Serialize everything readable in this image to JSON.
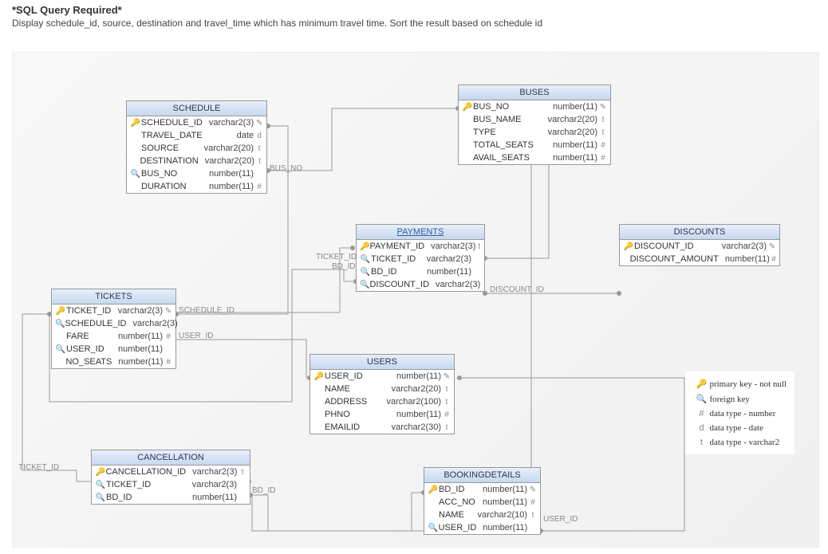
{
  "header": {
    "title": "*SQL Query Required*",
    "subtitle": "Display schedule_id, source, destination and travel_time which has minimum travel time. Sort the result based on schedule id"
  },
  "tables": {
    "schedule": {
      "title": "SCHEDULE",
      "cols": [
        {
          "ico": "pk",
          "name": "SCHEDULE_ID",
          "type": "varchar2(3)",
          "flag": "✎"
        },
        {
          "ico": "",
          "name": "TRAVEL_DATE",
          "type": "date",
          "flag": "d"
        },
        {
          "ico": "",
          "name": "SOURCE",
          "type": "varchar2(20)",
          "flag": "t"
        },
        {
          "ico": "",
          "name": "DESTINATION",
          "type": "varchar2(20)",
          "flag": "t"
        },
        {
          "ico": "fk",
          "name": "BUS_NO",
          "type": "number(11)",
          "flag": ""
        },
        {
          "ico": "",
          "name": "DURATION",
          "type": "number(11)",
          "flag": "#"
        }
      ]
    },
    "buses": {
      "title": "BUSES",
      "cols": [
        {
          "ico": "pk",
          "name": "BUS_NO",
          "type": "number(11)",
          "flag": "✎"
        },
        {
          "ico": "",
          "name": "BUS_NAME",
          "type": "varchar2(20)",
          "flag": "t"
        },
        {
          "ico": "",
          "name": "TYPE",
          "type": "varchar2(20)",
          "flag": "t"
        },
        {
          "ico": "",
          "name": "TOTAL_SEATS",
          "type": "number(11)",
          "flag": "#"
        },
        {
          "ico": "",
          "name": "AVAIL_SEATS",
          "type": "number(11)",
          "flag": "#"
        }
      ]
    },
    "payments": {
      "title": "PAYMENTS",
      "cols": [
        {
          "ico": "pk",
          "name": "PAYMENT_ID",
          "type": "varchar2(3)",
          "flag": "t"
        },
        {
          "ico": "fk",
          "name": "TICKET_ID",
          "type": "varchar2(3)",
          "flag": ""
        },
        {
          "ico": "fk",
          "name": "BD_ID",
          "type": "number(11)",
          "flag": ""
        },
        {
          "ico": "fk",
          "name": "DISCOUNT_ID",
          "type": "varchar2(3)",
          "flag": ""
        }
      ]
    },
    "discounts": {
      "title": "DISCOUNTS",
      "cols": [
        {
          "ico": "pk",
          "name": "DISCOUNT_ID",
          "type": "varchar2(3)",
          "flag": "✎"
        },
        {
          "ico": "",
          "name": "DISCOUNT_AMOUNT",
          "type": "number(11)",
          "flag": "#"
        }
      ]
    },
    "tickets": {
      "title": "TICKETS",
      "cols": [
        {
          "ico": "pk",
          "name": "TICKET_ID",
          "type": "varchar2(3)",
          "flag": "✎"
        },
        {
          "ico": "fk",
          "name": "SCHEDULE_ID",
          "type": "varchar2(3)",
          "flag": ""
        },
        {
          "ico": "",
          "name": "FARE",
          "type": "number(11)",
          "flag": "#"
        },
        {
          "ico": "fk",
          "name": "USER_ID",
          "type": "number(11)",
          "flag": ""
        },
        {
          "ico": "",
          "name": "NO_SEATS",
          "type": "number(11)",
          "flag": "#"
        }
      ]
    },
    "users": {
      "title": "USERS",
      "cols": [
        {
          "ico": "pk",
          "name": "USER_ID",
          "type": "number(11)",
          "flag": "✎"
        },
        {
          "ico": "",
          "name": "NAME",
          "type": "varchar2(20)",
          "flag": "t"
        },
        {
          "ico": "",
          "name": "ADDRESS",
          "type": "varchar2(100)",
          "flag": "t"
        },
        {
          "ico": "",
          "name": "PHNO",
          "type": "number(11)",
          "flag": "#"
        },
        {
          "ico": "",
          "name": "EMAILID",
          "type": "varchar2(30)",
          "flag": "t"
        }
      ]
    },
    "cancellation": {
      "title": "CANCELLATION",
      "cols": [
        {
          "ico": "pk",
          "name": "CANCELLATION_ID",
          "type": "varchar2(3)",
          "flag": "t"
        },
        {
          "ico": "fk",
          "name": "TICKET_ID",
          "type": "varchar2(3)",
          "flag": ""
        },
        {
          "ico": "fk",
          "name": "BD_ID",
          "type": "number(11)",
          "flag": ""
        }
      ]
    },
    "bookingdetails": {
      "title": "BOOKINGDETAILS",
      "cols": [
        {
          "ico": "pk",
          "name": "BD_ID",
          "type": "number(11)",
          "flag": "✎"
        },
        {
          "ico": "",
          "name": "ACC_NO",
          "type": "number(11)",
          "flag": "#"
        },
        {
          "ico": "",
          "name": "NAME",
          "type": "varchar2(10)",
          "flag": "t"
        },
        {
          "ico": "fk",
          "name": "USER_ID",
          "type": "number(11)",
          "flag": ""
        }
      ]
    }
  },
  "rel_labels": {
    "bus_no": "BUS_NO",
    "ticket_id1": "TICKET_ID",
    "bd_id1": "BD_ID",
    "discount_id": "DISCOUNT_ID",
    "schedule_id": "SCHEDULE_ID",
    "user_id1": "USER_ID",
    "user_id2": "USER_ID",
    "ticket_id2": "TICKET_ID",
    "bd_id2": "BD_ID"
  },
  "legend": {
    "pk": "primary key - not null",
    "fk": "foreign key",
    "num": "data type - number",
    "date": "data type - date",
    "vc": "data type - varchar2"
  }
}
